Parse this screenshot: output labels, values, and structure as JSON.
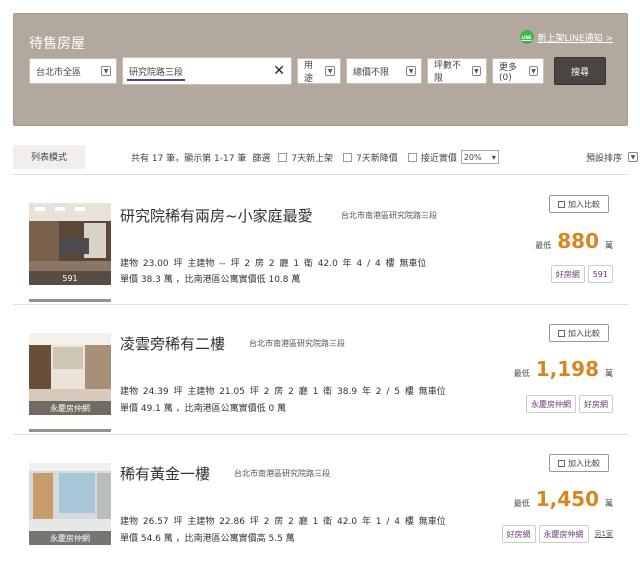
{
  "panel": {
    "title": "待售房屋",
    "line_badge": "LINE",
    "line_notify": "新上架LINE通知 >"
  },
  "filters": {
    "district": "台北市全區",
    "keyword": "研究院路三段",
    "usage": "用途",
    "total_price": "總價不限",
    "area": "坪數不限",
    "more": "更多(0)",
    "search_button": "搜尋"
  },
  "toolbar": {
    "list_mode": "列表模式",
    "summary": "共有 17 筆，顯示第 1-17 筆",
    "filter_label": "篩選",
    "new_7days": "7天新上架",
    "price_drop_7days": "7天新降價",
    "near_actual": "接近實價",
    "pct": "20%",
    "sort": "預設排序"
  },
  "listings": [
    {
      "title": "研究院稀有兩房~小家庭最愛",
      "address": "台北市南港區研究院路三段",
      "specs": "建物 23.00 坪   主建物 -- 坪   2 房 2 廳 1 衛   42.0 年   4 / 4 樓   無車位",
      "unit_price": "單價 38.3 萬 ，比南港區公寓實價低 10.8 萬",
      "thumb_label": "591",
      "compare": "加入比較",
      "price_label": "最低",
      "price": "880",
      "price_unit": "萬",
      "tags": [
        "好房網",
        "591"
      ]
    },
    {
      "title": "凌雲旁稀有二樓",
      "address": "台北市南港區研究院路三段",
      "specs": "建物 24.39 坪   主建物 21.05 坪   2 房 2 廳 1 衛   38.9 年   2 / 5 樓   無車位",
      "unit_price": "單價 49.1 萬 ，比南港區公寓實價低 0 萬",
      "thumb_label": "永慶房仲網",
      "compare": "加入比較",
      "price_label": "最低",
      "price": "1,198",
      "price_unit": "萬",
      "tags": [
        "永慶房仲網",
        "好房網"
      ]
    },
    {
      "title": "稀有黃金一樓",
      "address": "台北市南港區研究院路三段",
      "specs": "建物 26.57 坪   主建物 22.86 坪   2 房 2 廳 1 衛   42.0 年   1 / 4 樓   無車位",
      "unit_price": "單價 54.6 萬 ，比南港區公寓實價高 5.5 萬",
      "thumb_label": "永慶房仲網",
      "compare": "加入比較",
      "price_label": "最低",
      "price": "1,450",
      "price_unit": "萬",
      "tags": [
        "好房網",
        "永慶房仲網"
      ],
      "more": "另1家"
    }
  ]
}
